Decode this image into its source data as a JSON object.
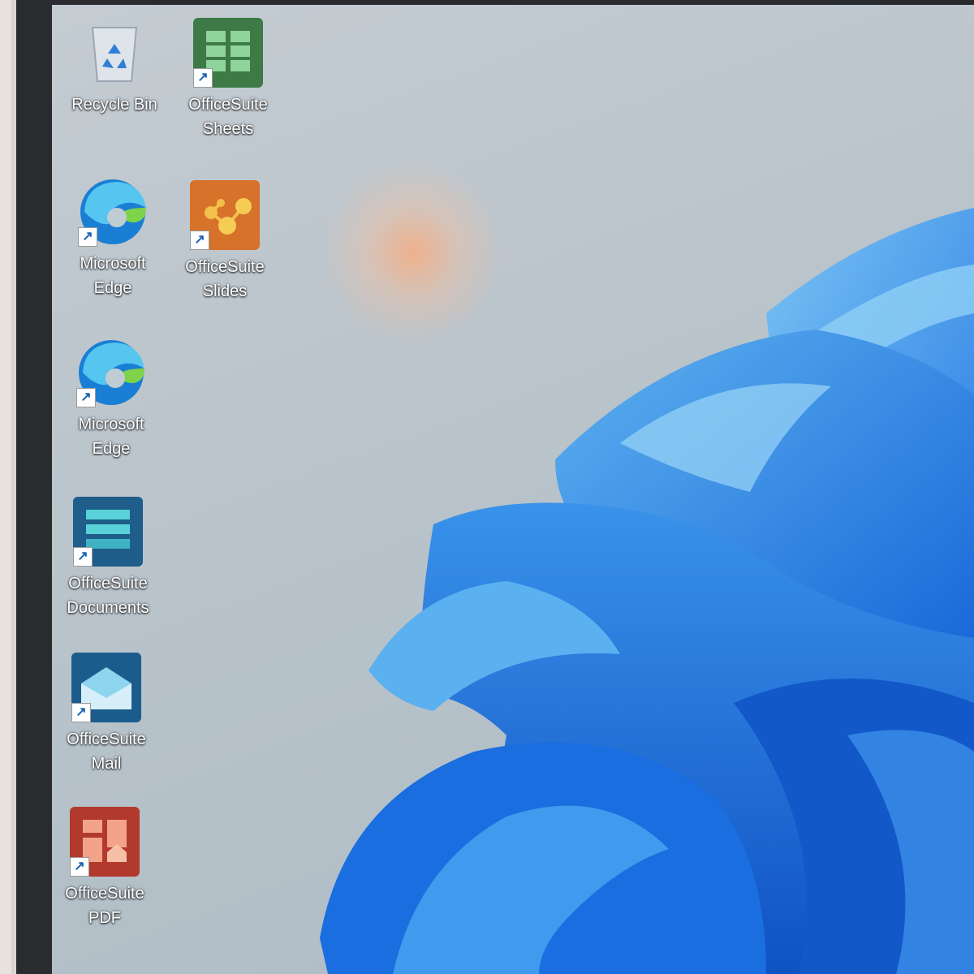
{
  "desktop": {
    "icons": [
      {
        "label": "Recycle Bin",
        "icon": "recycle-bin-icon"
      },
      {
        "label": "OfficeSuite\nSheets",
        "icon": "sheets-icon"
      },
      {
        "label": "Microsoft\nEdge",
        "icon": "edge-icon"
      },
      {
        "label": "OfficeSuite\nSlides",
        "icon": "slides-icon"
      },
      {
        "label": "Microsoft\nEdge",
        "icon": "edge-icon"
      },
      {
        "label": "OfficeSuite\nDocuments",
        "icon": "documents-icon"
      },
      {
        "label": "OfficeSuite\nMail",
        "icon": "mail-icon"
      },
      {
        "label": "OfficeSuite\nPDF",
        "icon": "pdf-icon"
      }
    ],
    "shortcut_glyph": "↗"
  },
  "colors": {
    "sheets": "#3d7a46",
    "slides": "#d6722a",
    "documents": "#1f5e8a",
    "mail": "#1c5c8c",
    "pdf": "#b23a2c",
    "wallpaper_bloom": "#1f7fe0"
  }
}
